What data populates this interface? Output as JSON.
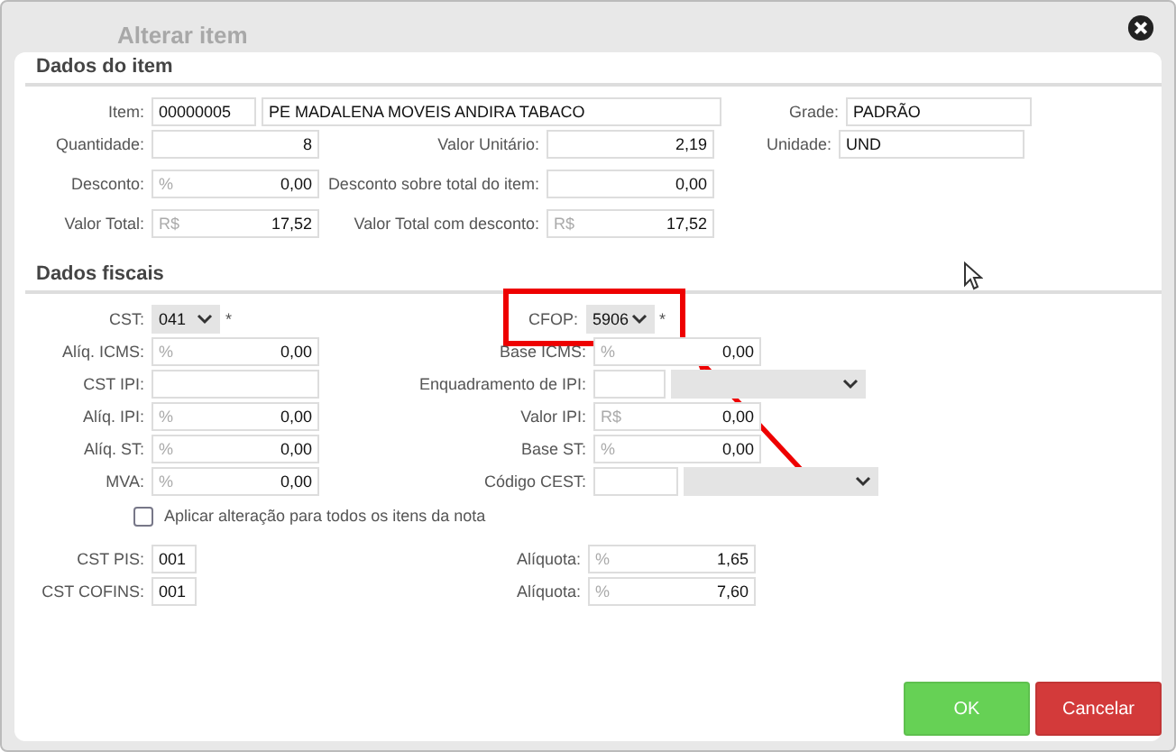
{
  "window": {
    "title": "Alterar item"
  },
  "sections": [
    {
      "kind": "item",
      "title": "Dados do item",
      "rows": [
        {
          "groups": [
            {
              "label": "Item:",
              "fields": [
                {
                  "kind": "code",
                  "value": "00000005"
                },
                {
                  "kind": "wide",
                  "value": "PE MADALENA MOVEIS ANDIRA TABACO"
                }
              ]
            },
            {
              "label": "Grade:",
              "fields": [
                {
                  "kind": "text",
                  "value": "PADRÃO"
                }
              ]
            }
          ]
        },
        {
          "groups": [
            {
              "label": "Quantidade:",
              "fields": [
                {
                  "kind": "number",
                  "value": "8"
                }
              ]
            },
            {
              "label": "Valor Unitário:",
              "fields": [
                {
                  "kind": "number",
                  "value": "2,19"
                }
              ]
            },
            {
              "label": "Unidade:",
              "fields": [
                {
                  "kind": "text",
                  "value": "UND"
                }
              ]
            }
          ]
        },
        {
          "groups": [
            {
              "label": "Desconto:",
              "fields": [
                {
                  "kind": "number",
                  "unit": "%",
                  "value": "0,00"
                }
              ]
            },
            {
              "label": "Desconto sobre total do item:",
              "fields": [
                {
                  "kind": "number",
                  "value": "0,00"
                }
              ]
            }
          ]
        },
        {
          "groups": [
            {
              "label": "Valor Total:",
              "fields": [
                {
                  "kind": "number",
                  "unit": "R$",
                  "value": "17,52"
                }
              ]
            },
            {
              "label": "Valor Total com desconto:",
              "fields": [
                {
                  "kind": "number",
                  "unit": "R$",
                  "value": "17,52"
                }
              ]
            }
          ]
        }
      ]
    },
    {
      "kind": "fiscal",
      "title": "Dados fiscais",
      "rows": [
        {
          "groups": [
            {
              "label": "CST:",
              "required": "*",
              "fields": [
                {
                  "kind": "select",
                  "value": "041"
                }
              ]
            },
            {
              "label": "CFOP:",
              "required": "*",
              "highlighted": true,
              "fields": [
                {
                  "kind": "select",
                  "value": "5906"
                }
              ]
            }
          ]
        },
        {
          "groups": [
            {
              "label": "Alíq. ICMS:",
              "fields": [
                {
                  "kind": "number",
                  "unit": "%",
                  "value": "0,00"
                }
              ]
            },
            {
              "label": "Base ICMS:",
              "fields": [
                {
                  "kind": "number",
                  "unit": "%",
                  "value": "0,00"
                }
              ]
            }
          ]
        },
        {
          "groups": [
            {
              "label": "CST IPI:",
              "fields": [
                {
                  "kind": "number"
                }
              ]
            },
            {
              "label": "Enquadramento de IPI:",
              "fields": [
                {
                  "kind": "small"
                },
                {
                  "kind": "combo"
                }
              ]
            }
          ]
        },
        {
          "groups": [
            {
              "label": "Alíq. IPI:",
              "fields": [
                {
                  "kind": "number",
                  "unit": "%",
                  "value": "0,00"
                }
              ]
            },
            {
              "label": "Valor IPI:",
              "fields": [
                {
                  "kind": "number",
                  "unit": "R$",
                  "value": "0,00"
                }
              ]
            }
          ]
        },
        {
          "groups": [
            {
              "label": "Alíq. ST:",
              "fields": [
                {
                  "kind": "number",
                  "unit": "%",
                  "value": "0,00"
                }
              ]
            },
            {
              "label": "Base ST:",
              "fields": [
                {
                  "kind": "number",
                  "unit": "%",
                  "value": "0,00"
                }
              ]
            }
          ]
        },
        {
          "groups": [
            {
              "label": "MVA:",
              "fields": [
                {
                  "kind": "number",
                  "unit": "%",
                  "value": "0,00"
                }
              ]
            },
            {
              "label": "Código CEST:",
              "fields": [
                {
                  "kind": "medium"
                },
                {
                  "kind": "combo"
                }
              ]
            }
          ]
        },
        {
          "checkbox": {
            "label": "Aplicar alteração para todos os itens da nota",
            "checked": false
          }
        },
        {
          "groups": [
            {
              "label": "CST PIS:",
              "fields": [
                {
                  "kind": "tiny",
                  "value": "001"
                }
              ]
            },
            {
              "label": "Alíquota:",
              "fields": [
                {
                  "kind": "number",
                  "unit": "%",
                  "value": "1,65"
                }
              ]
            }
          ]
        },
        {
          "groups": [
            {
              "label": "CST COFINS:",
              "fields": [
                {
                  "kind": "tiny",
                  "value": "001"
                }
              ]
            },
            {
              "label": "Alíquota:",
              "fields": [
                {
                  "kind": "number",
                  "unit": "%",
                  "value": "7,60"
                }
              ]
            }
          ]
        }
      ]
    }
  ],
  "buttons": [
    {
      "kind": "confirm",
      "label": "OK"
    },
    {
      "kind": "cancel",
      "label": "Cancelar"
    }
  ]
}
